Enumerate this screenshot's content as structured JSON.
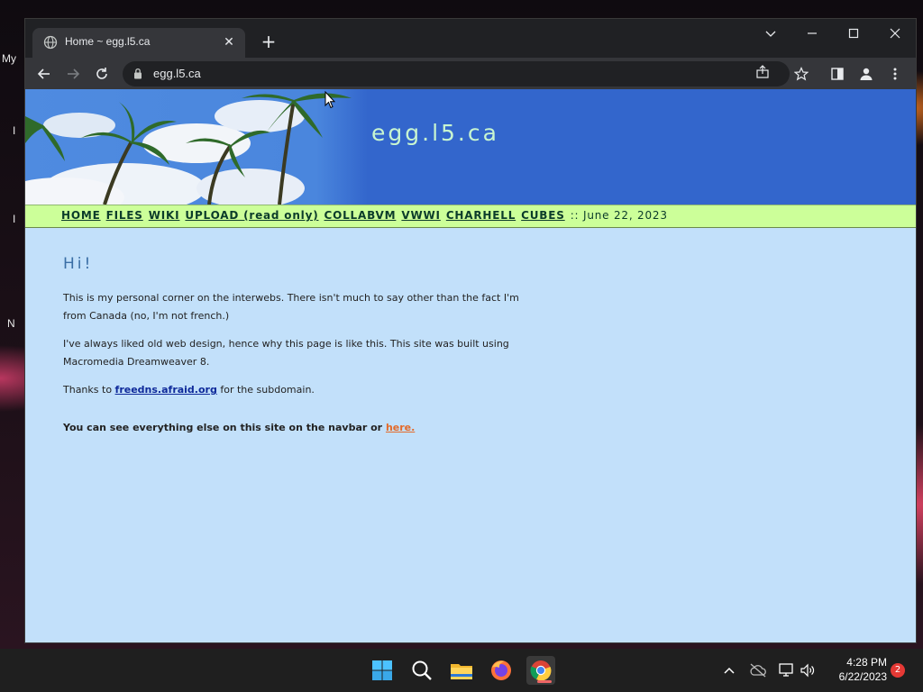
{
  "desktop": {
    "label_my": "My",
    "label_n": "N",
    "label_i1": "I",
    "label_i2": "I"
  },
  "browser": {
    "tab_title": "Home ~ egg.l5.ca",
    "url": "egg.l5.ca"
  },
  "page": {
    "site_title": "egg.l5.ca",
    "nav": {
      "links": [
        "HOME",
        "FILES",
        "WIKI",
        "UPLOAD (read only)",
        "COLLABVM",
        "VWWI",
        "CHARHELL",
        "CUBES"
      ],
      "separator": "::",
      "date": "June 22, 2023"
    },
    "heading": "Hi!",
    "para1": "This is my personal corner on the interwebs. There isn't much to say other than the fact I'm from Canada (no, I'm not french.)",
    "para2": "I've always liked old web design, hence why this page is like this. This site was built using Macromedia Dreamweaver 8.",
    "para3_before": "Thanks to",
    "para3_link": "freedns.afraid.org",
    "para3_after": "for the subdomain.",
    "para4_text": "You can see everything else on this site on the navbar or",
    "para4_link": "here."
  },
  "taskbar": {
    "time": "4:28 PM",
    "date": "6/22/2023",
    "notification_count": "2",
    "icons": [
      "windows-start-icon",
      "search-icon",
      "file-explorer-icon",
      "firefox-icon",
      "chrome-icon"
    ]
  },
  "colors": {
    "banner_blue": "#3366cc",
    "navbar_green": "#ccff99",
    "page_bg": "#c2e0fa",
    "link_orange": "#e36a2a",
    "link_blue": "#0f2a9a"
  }
}
